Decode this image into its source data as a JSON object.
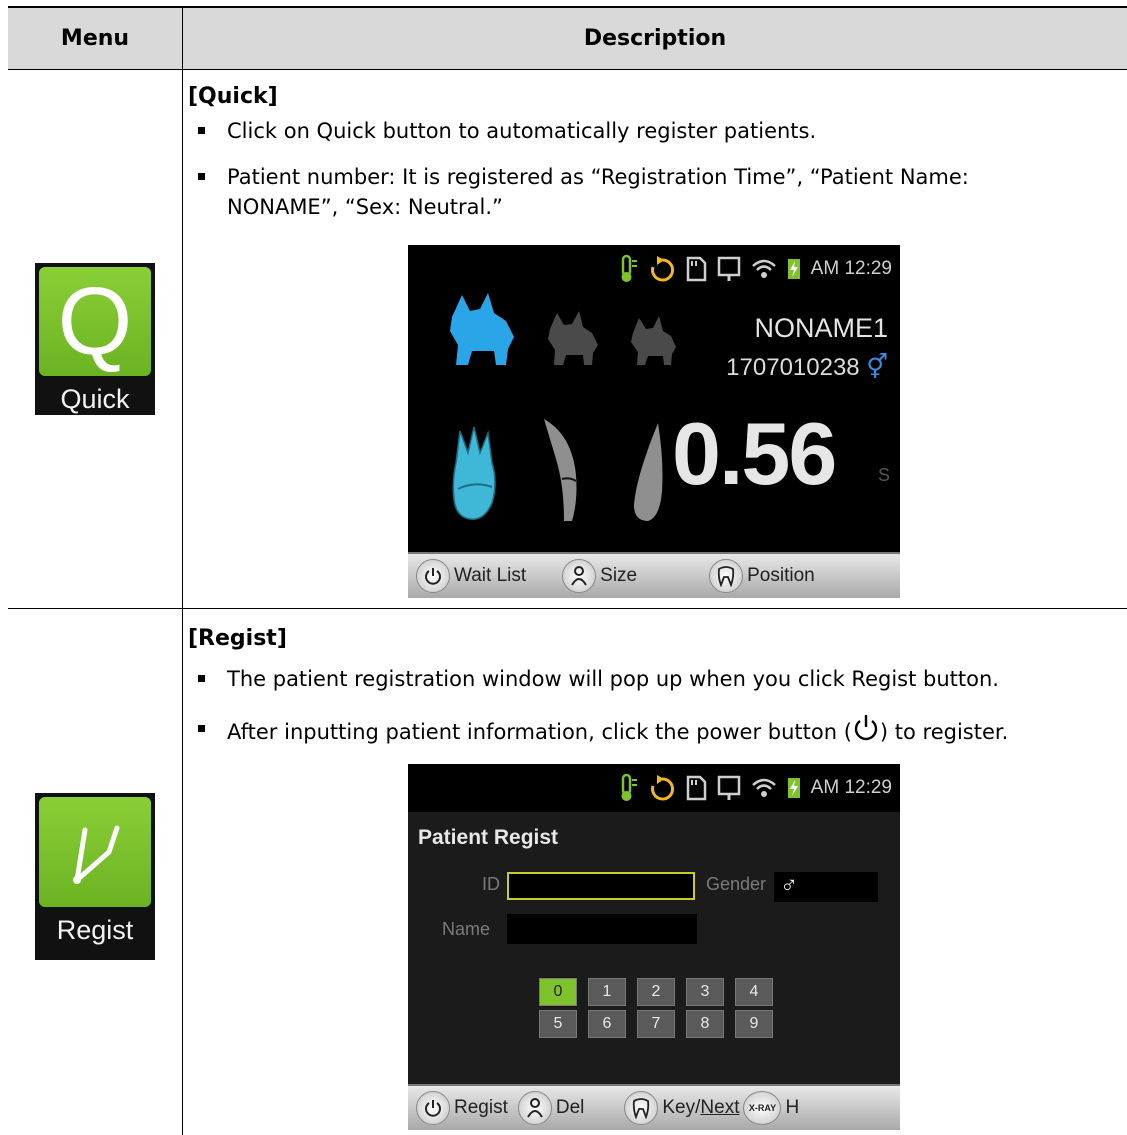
{
  "table": {
    "headers": [
      "Menu",
      "Description"
    ]
  },
  "quick": {
    "icon_label": "Quick",
    "icon_glyph": "Q",
    "title": "[Quick]",
    "bullets": [
      "Click on Quick button to automatically register patients.",
      "Patient number: It is registered as “Registration Time”, “Patient Name:",
      "NONAME”, “Sex: Neutral.”"
    ],
    "screen": {
      "time": "AM 12:29",
      "patient_name": "NONAME1",
      "patient_id": "1707010238",
      "gender_symbol": "⚥",
      "value": "0.56",
      "unit": "S",
      "buttons": [
        "Wait List",
        "Size",
        "Position"
      ]
    }
  },
  "regist": {
    "icon_label": "Regist",
    "title": "[Regist]",
    "bullets": [
      "The patient registration window will pop up when you click Regist button.",
      "After inputting patient information, click the power button (",
      ") to register."
    ],
    "screen": {
      "time": "AM 12:29",
      "window_title": "Patient Regist",
      "id_label": "ID",
      "id_value": "",
      "gender_label": "Gender",
      "gender_value": "♂",
      "name_label": "Name",
      "name_value": "",
      "keys_row1": [
        "0",
        "1",
        "2",
        "3",
        "4"
      ],
      "keys_row2": [
        "5",
        "6",
        "7",
        "8",
        "9"
      ],
      "selected_key": "0",
      "buttons": {
        "regist": "Regist",
        "del": "Del",
        "key": "Key/",
        "next": "Next",
        "xray": "X-RAY",
        "h": "H"
      }
    }
  },
  "colors": {
    "accent_green": "#7ec22c",
    "dog_active": "#2aa6e8",
    "tooth_active": "#3fb8d8",
    "icon_gray": "#5a5a5a"
  }
}
